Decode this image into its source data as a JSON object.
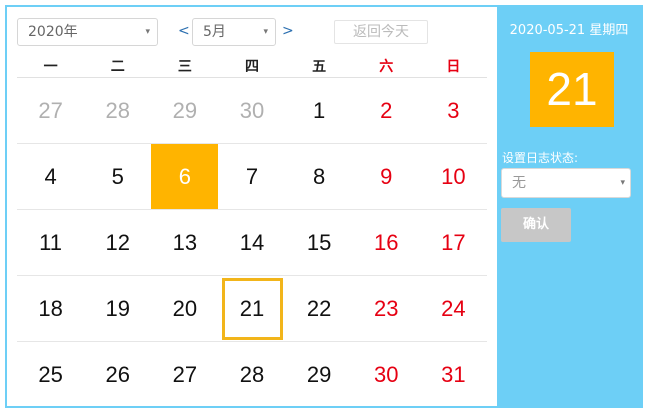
{
  "toolbar": {
    "year_value": "2020年",
    "month_value": "5月",
    "prev_symbol": "<",
    "next_symbol": ">",
    "today_label": "返回今天",
    "caret_symbol": "▾"
  },
  "weekdays": [
    {
      "label": "一",
      "weekend": false
    },
    {
      "label": "二",
      "weekend": false
    },
    {
      "label": "三",
      "weekend": false
    },
    {
      "label": "四",
      "weekend": false
    },
    {
      "label": "五",
      "weekend": false
    },
    {
      "label": "六",
      "weekend": true
    },
    {
      "label": "日",
      "weekend": true
    }
  ],
  "days": [
    {
      "label": "27",
      "other": true
    },
    {
      "label": "28",
      "other": true
    },
    {
      "label": "29",
      "other": true
    },
    {
      "label": "30",
      "other": true
    },
    {
      "label": "1"
    },
    {
      "label": "2",
      "weekend": true
    },
    {
      "label": "3",
      "weekend": true
    },
    {
      "label": "4"
    },
    {
      "label": "5"
    },
    {
      "label": "6",
      "selected": true
    },
    {
      "label": "7"
    },
    {
      "label": "8"
    },
    {
      "label": "9",
      "weekend": true
    },
    {
      "label": "10",
      "weekend": true
    },
    {
      "label": "11"
    },
    {
      "label": "12"
    },
    {
      "label": "13"
    },
    {
      "label": "14"
    },
    {
      "label": "15"
    },
    {
      "label": "16",
      "weekend": true
    },
    {
      "label": "17",
      "weekend": true
    },
    {
      "label": "18"
    },
    {
      "label": "19"
    },
    {
      "label": "20"
    },
    {
      "label": "21",
      "today": true
    },
    {
      "label": "22"
    },
    {
      "label": "23",
      "weekend": true
    },
    {
      "label": "24",
      "weekend": true
    },
    {
      "label": "25"
    },
    {
      "label": "26"
    },
    {
      "label": "27"
    },
    {
      "label": "28"
    },
    {
      "label": "29"
    },
    {
      "label": "30",
      "weekend": true
    },
    {
      "label": "31",
      "weekend": true
    }
  ],
  "side": {
    "date_text": "2020-05-21 星期四",
    "big_day": "21",
    "status_label": "设置日志状态:",
    "status_value": "无",
    "confirm_label": "确认"
  },
  "colors": {
    "accent_blue": "#6dcff6",
    "highlight_orange": "#ffb400",
    "today_border": "#f2b51a",
    "weekend_red": "#e60012",
    "muted_gray": "#b0b0b0",
    "nav_blue": "#2b6fb0",
    "disabled_button": "#c7c7c7"
  }
}
